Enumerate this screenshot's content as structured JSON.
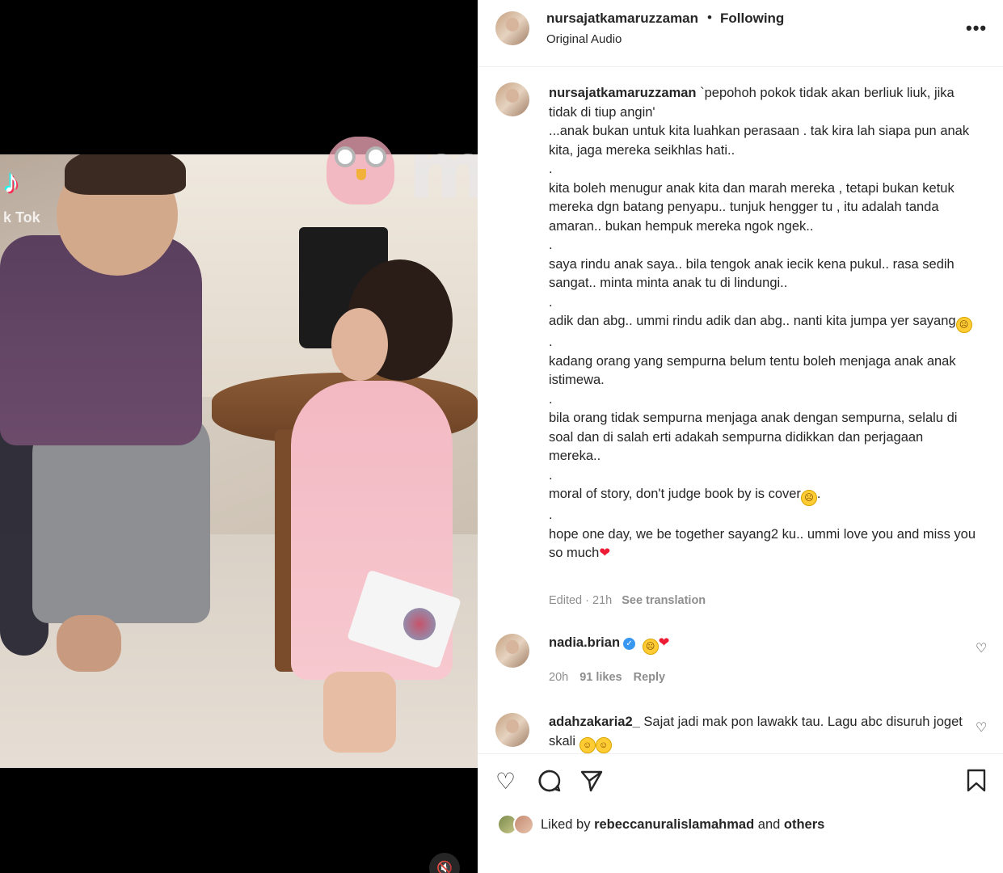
{
  "media": {
    "watermark_text": "muroi",
    "tiktok_label": "k Tok",
    "mute_icon": "speaker-muted-icon"
  },
  "header": {
    "username": "nursajatkamaruzzaman",
    "separator": "•",
    "follow_status": "Following",
    "audio_label": "Original Audio",
    "more_icon": "more-options-icon",
    "more_label": "•••"
  },
  "caption": {
    "username": "nursajatkamaruzzaman",
    "lines": [
      "`pepohoh pokok tidak akan berliuk liuk, jika tidak di tiup angin'",
      "...anak bukan untuk kita luahkan perasaan . tak kira lah siapa pun anak kita, jaga mereka seikhlas hati..",
      ".",
      "kita boleh menugur anak kita dan marah mereka , tetapi bukan ketuk mereka dgn batang penyapu.. tunjuk hengger tu , itu adalah tanda amaran.. bukan hempuk mereka ngok ngek..",
      ".",
      "saya rindu anak saya.. bila tengok anak iecik kena pukul.. rasa sedih sangat.. minta minta anak tu di lindungi..",
      ".",
      "adik dan abg.. ummi rindu adik dan abg.. nanti kita jumpa yer sayang",
      ".",
      "kadang orang yang sempurna belum tentu boleh menjaga anak anak istimewa.",
      ".",
      "bila orang tidak sempurna menjaga anak dengan sempurna, selalu di soal dan di salah erti adakah sempurna didikkan dan perjagaan mereka..",
      ".",
      "moral of story, don't judge book by is cover",
      ".",
      "hope one day, we be together sayang2 ku.. ummi love you and miss you so much"
    ],
    "edited": "Edited · 21h",
    "see_translation": "See translation"
  },
  "comments": [
    {
      "username": "nadia.brian",
      "text": "",
      "time": "20h",
      "likes": "91 likes",
      "reply": "Reply"
    },
    {
      "username": "adahzakaria2_",
      "text": "Sajat jadi mak pon lawakk tau. Lagu abc disuruh joget skali"
    }
  ],
  "actions": {
    "like_icon": "heart-icon",
    "comment_icon": "comment-bubble-icon",
    "share_icon": "send-icon",
    "save_icon": "bookmark-icon",
    "liked_prefix": "Liked by",
    "liked_user": "rebeccanuralislamahmad",
    "liked_and": "and",
    "liked_others": "others"
  },
  "colors": {
    "text_primary": "#262626",
    "text_secondary": "#8e8e8e",
    "verified_blue": "#3897f0",
    "heart_red": "#ed1c34",
    "divider": "#efefef"
  }
}
